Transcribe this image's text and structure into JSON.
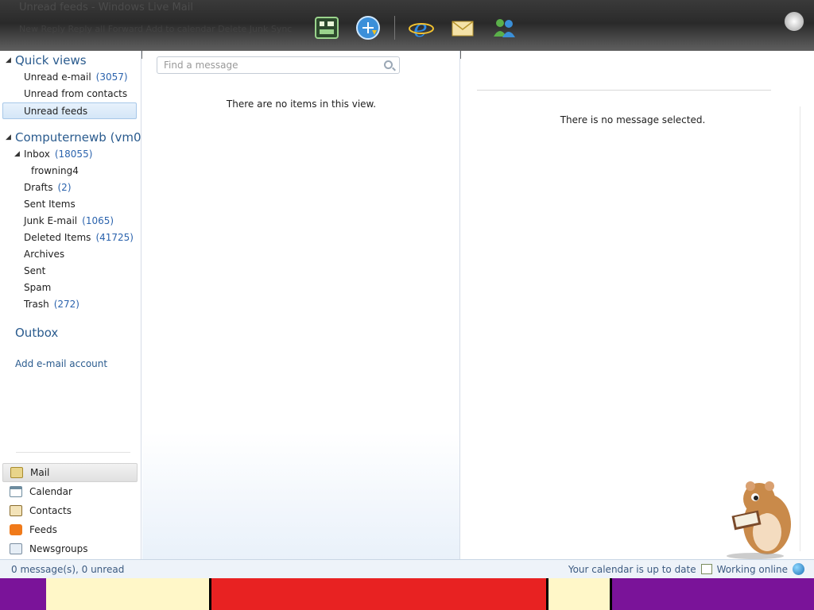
{
  "dock": {
    "ghost_title": "Unread feeds - Windows Live Mail",
    "ghost_menu": "New  Reply  Reply all  Forward  Add to calendar  Delete  Junk  Sync",
    "icons": [
      "app-icon",
      "globe-download-icon",
      "internet-explorer-icon",
      "mail-icon",
      "messenger-icon"
    ]
  },
  "nav": {
    "quick_views": {
      "title": "Quick views",
      "items": [
        {
          "label": "Unread e-mail",
          "count": "(3057)"
        },
        {
          "label": "Unread from contacts",
          "count": ""
        },
        {
          "label": "Unread feeds",
          "count": ""
        }
      ]
    },
    "account": {
      "title": "Computernewb (vm0...",
      "folders": [
        {
          "label": "Inbox",
          "count": "(18055)"
        },
        {
          "label": "frowning4",
          "count": ""
        },
        {
          "label": "Drafts",
          "count": "(2)"
        },
        {
          "label": "Sent Items",
          "count": ""
        },
        {
          "label": "Junk E-mail",
          "count": "(1065)"
        },
        {
          "label": "Deleted Items",
          "count": "(41725)"
        },
        {
          "label": "Archives",
          "count": ""
        },
        {
          "label": "Sent",
          "count": ""
        },
        {
          "label": "Spam",
          "count": ""
        },
        {
          "label": "Trash",
          "count": "(272)"
        }
      ]
    },
    "outbox": "Outbox",
    "add_account": "Add e-mail account",
    "switcher": [
      {
        "label": "Mail",
        "icon": "mail-icon"
      },
      {
        "label": "Calendar",
        "icon": "calendar-icon"
      },
      {
        "label": "Contacts",
        "icon": "contacts-icon"
      },
      {
        "label": "Feeds",
        "icon": "rss-feed-icon"
      },
      {
        "label": "Newsgroups",
        "icon": "newsgroups-icon"
      }
    ]
  },
  "list": {
    "search_placeholder": "Find a message",
    "empty": "There are no items in this view."
  },
  "reader": {
    "empty": "There is no message selected."
  },
  "status": {
    "left": "0 message(s), 0 unread",
    "calendar": "Your calendar is up to date",
    "online": "Working online"
  },
  "colors": {
    "accent": "#2a5b8e",
    "count": "#2b63ad",
    "selection": "#d4e6f7"
  }
}
